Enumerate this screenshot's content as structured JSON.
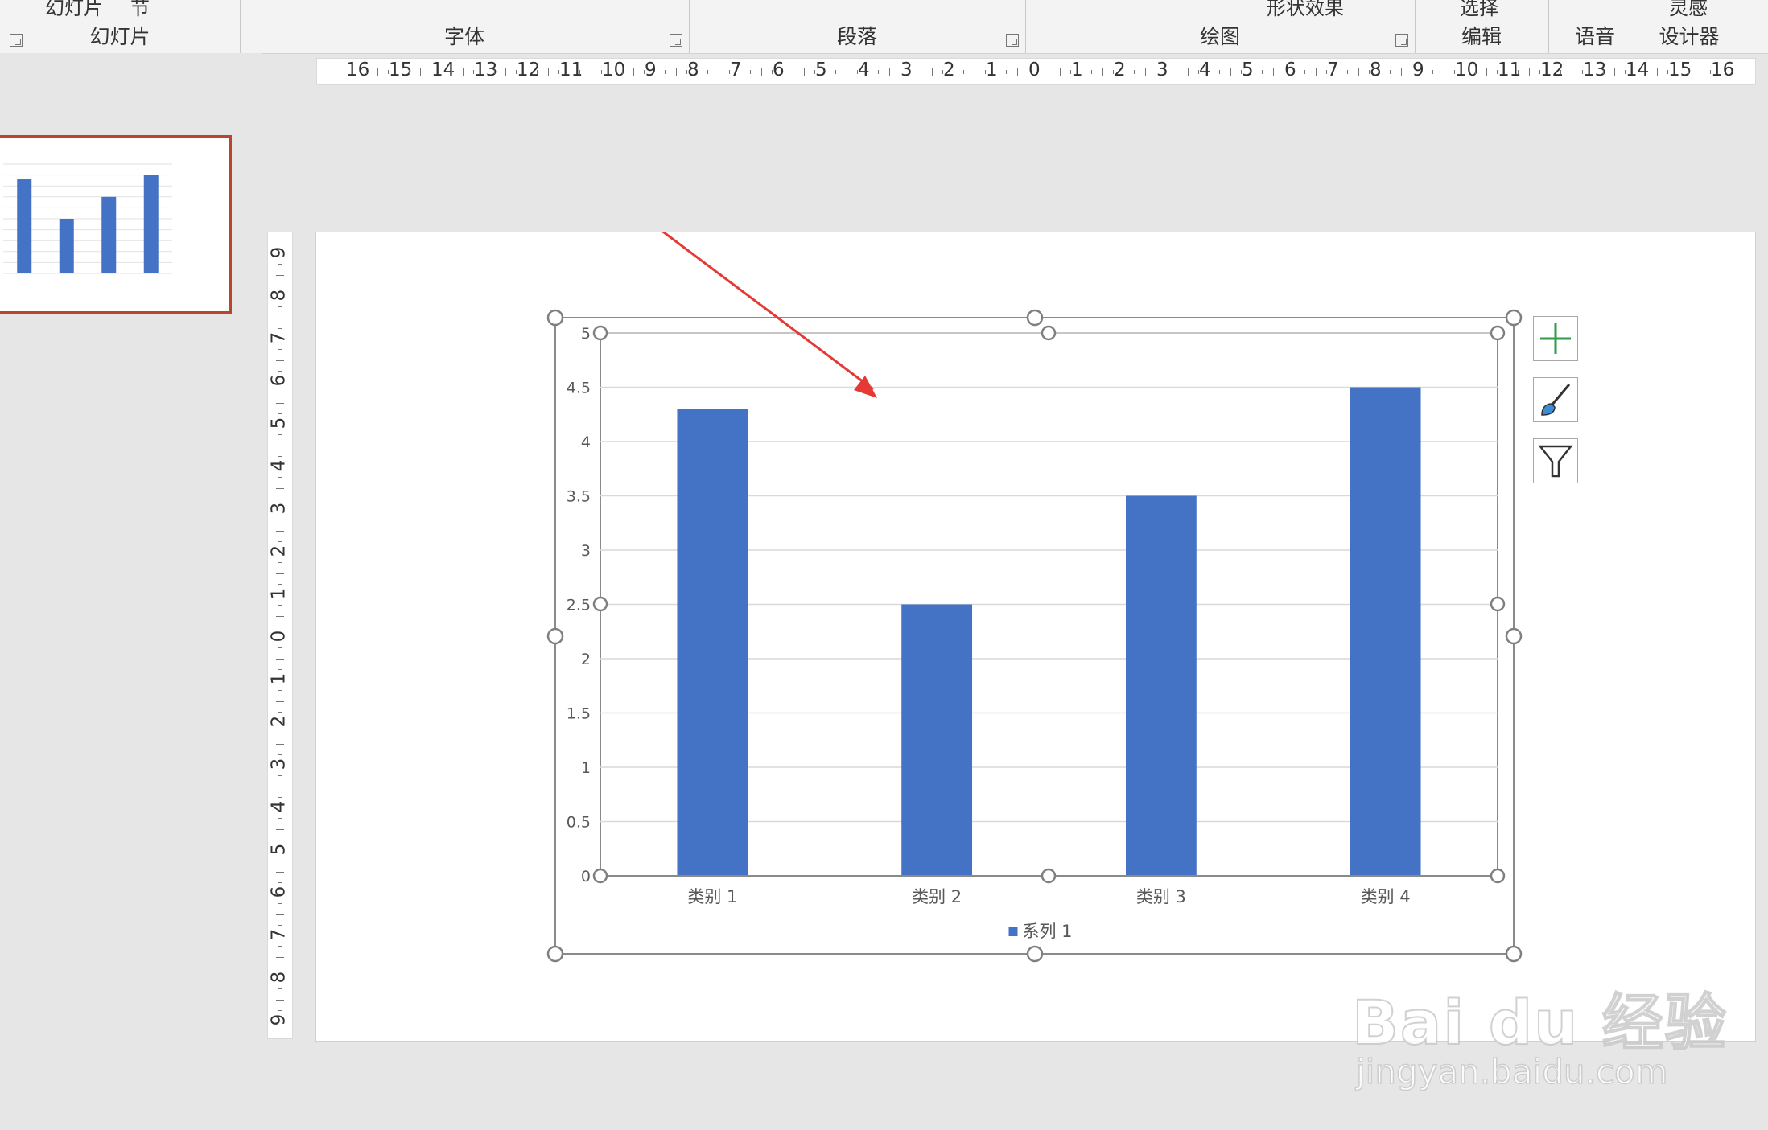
{
  "ribbon": {
    "groups": [
      {
        "label": "幻灯片",
        "commands": [
          "幻灯片",
          "节"
        ]
      },
      {
        "label": "字体"
      },
      {
        "label": "段落"
      },
      {
        "label": "绘图",
        "commands": [
          "形状效果"
        ]
      },
      {
        "label": "编辑",
        "commands": [
          "选择"
        ]
      },
      {
        "label": "语音"
      },
      {
        "label": "设计器",
        "commands": [
          "灵感"
        ]
      }
    ]
  },
  "ruler": {
    "horizontal": [
      "16",
      "15",
      "14",
      "13",
      "12",
      "11",
      "10",
      "9",
      "8",
      "7",
      "6",
      "5",
      "4",
      "3",
      "2",
      "1",
      "0",
      "1",
      "2",
      "3",
      "4",
      "5",
      "6",
      "7",
      "8",
      "9",
      "10",
      "11",
      "12",
      "13",
      "14",
      "15",
      "16"
    ],
    "vertical": [
      "9",
      "8",
      "7",
      "6",
      "5",
      "4",
      "3",
      "2",
      "1",
      "0",
      "1",
      "2",
      "3",
      "4",
      "5",
      "6",
      "7",
      "8",
      "9"
    ]
  },
  "chart_data": {
    "type": "bar",
    "categories": [
      "类别 1",
      "类别 2",
      "类别 3",
      "类别 4"
    ],
    "series": [
      {
        "name": "系列 1",
        "values": [
          4.3,
          2.5,
          3.5,
          4.5
        ],
        "color": "#4472c4"
      }
    ],
    "ylim": [
      0,
      5
    ],
    "yticks": [
      "0",
      "0.5",
      "1",
      "1.5",
      "2",
      "2.5",
      "3",
      "3.5",
      "4",
      "4.5",
      "5"
    ],
    "grid": true,
    "legend": "bottom"
  },
  "colors": {
    "accent_red": "#b7472a",
    "bar": "#4472c4",
    "arrow": "#e53935",
    "plus_icon": "#2e9e4a",
    "brush_icon": "#3a8ed8"
  },
  "watermark": {
    "text": "Bai du 经验",
    "url": "jingyan.baidu.com"
  }
}
